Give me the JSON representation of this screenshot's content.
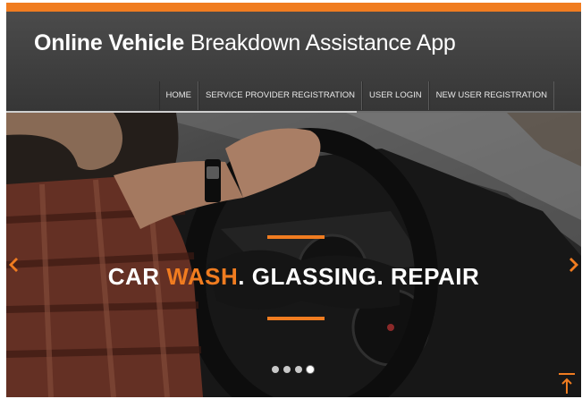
{
  "header": {
    "title_bold": "Online Vehicle",
    "title_rest": "Breakdown Assistance App"
  },
  "nav": {
    "items": [
      {
        "label": "HOME"
      },
      {
        "label": "SERVICE PROVIDER REGISTRATION"
      },
      {
        "label": "USER LOGIN"
      },
      {
        "label": "NEW USER REGISTRATION"
      }
    ]
  },
  "slider": {
    "headline_part1": "CAR ",
    "headline_accent": "WASH",
    "headline_part2": ". GLASSING. REPAIR",
    "progress_fraction": 0.61,
    "dots_count": 4,
    "active_dot_number": 4
  },
  "colors": {
    "accent": "#f07c20",
    "header_bg": "#444444",
    "nav_text": "#e8e8e8"
  },
  "icons": {
    "prev": "chevron-left-icon",
    "next": "chevron-right-icon",
    "scroll_top": "arrow-up-icon"
  }
}
